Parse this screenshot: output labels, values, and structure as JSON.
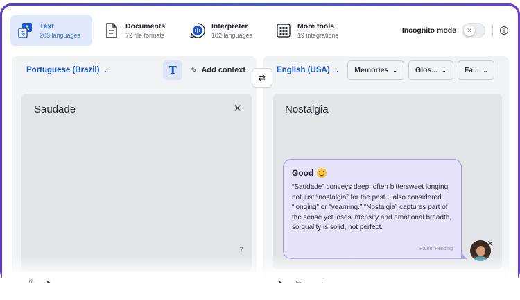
{
  "tabs": [
    {
      "label": "Text",
      "sub": "203 languages"
    },
    {
      "label": "Documents",
      "sub": "72 file formats"
    },
    {
      "label": "Interpreter",
      "sub": "182 languages"
    },
    {
      "label": "More tools",
      "sub": "19 integrations"
    }
  ],
  "incognito": {
    "label": "Incognito mode",
    "state": "off"
  },
  "source": {
    "language": "Portuguese (Brazil)",
    "add_context": "Add context",
    "text": "Saudade",
    "char_count": "7"
  },
  "target": {
    "language": "English (USA)",
    "memories": "Memories",
    "glossary": "Glos...",
    "formality": "Fa...",
    "text": "Nostalgia"
  },
  "feedback": {
    "title": "Good",
    "body": "“Saudade” conveys deep, often bittersweet longing, not just “nostalgia” for the past. I also considered “longing” or “yearning.” “Nostalgia” captures part of the sense yet loses intensity and emotional breadth, so quality is solid, not perfect.",
    "patent": "Patent Pending"
  },
  "colors": {
    "accent": "#1a56c7",
    "bubble": "#e7e3fb",
    "frame": "#4a4fd0"
  }
}
